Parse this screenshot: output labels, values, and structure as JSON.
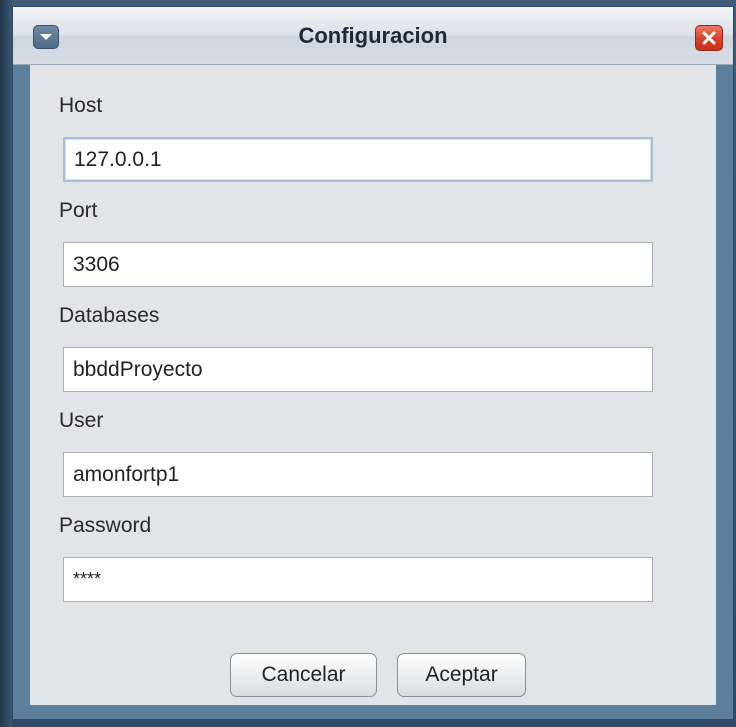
{
  "window": {
    "title": "Configuracion",
    "menu_icon": "chevron-down-icon",
    "close_icon": "close-icon"
  },
  "form": {
    "host": {
      "label": "Host",
      "value": "127.0.0.1"
    },
    "port": {
      "label": "Port",
      "value": "3306"
    },
    "databases": {
      "label": "Databases",
      "value": "bbddProyecto"
    },
    "user": {
      "label": "User",
      "value": "amonfortp1"
    },
    "password": {
      "label": "Password",
      "value": "****"
    }
  },
  "buttons": {
    "cancel_label": "Cancelar",
    "accept_label": "Aceptar"
  },
  "colors": {
    "content_bg": "#e3e4e8",
    "frame": "#5c7f9e",
    "close_red": "#d8412c"
  }
}
